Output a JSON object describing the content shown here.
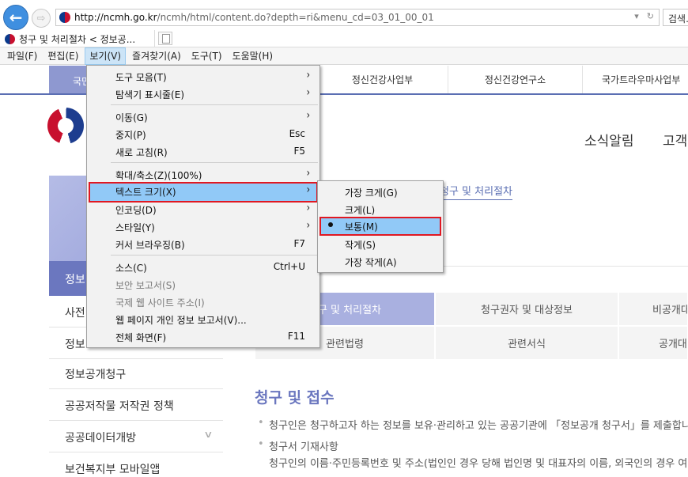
{
  "browser": {
    "url_prefix": "http://ncmh.go.kr",
    "url_rest": "/ncmh/html/content.do?depth=ri&menu_cd=03_01_00_01",
    "search_label": "검색...",
    "tab_title": "청구 및 처리절차 < 정보공...",
    "menubar": [
      "파일(F)",
      "편집(E)",
      "보기(V)",
      "즐겨찾기(A)",
      "도구(T)",
      "도움말(H)"
    ]
  },
  "view_menu": {
    "items": [
      {
        "label": "도구 모음(T)",
        "arrow": "›"
      },
      {
        "label": "탐색기 표시줄(E)",
        "arrow": "›"
      },
      {
        "label": "이동(G)",
        "arrow": "›"
      },
      {
        "label": "중지(P)",
        "shortcut": "Esc"
      },
      {
        "label": "새로 고침(R)",
        "shortcut": "F5"
      },
      {
        "label": "확대/축소(Z)(100%)",
        "arrow": "›"
      },
      {
        "label": "텍스트 크기(X)",
        "arrow": "›"
      },
      {
        "label": "인코딩(D)",
        "arrow": "›"
      },
      {
        "label": "스타일(Y)",
        "arrow": "›"
      },
      {
        "label": "커서 브라우징(B)",
        "shortcut": "F7"
      },
      {
        "label": "소스(C)",
        "shortcut": "Ctrl+U"
      },
      {
        "label": "보안 보고서(S)"
      },
      {
        "label": "국제 웹 사이트 주소(I)"
      },
      {
        "label": "웹 페이지 개인 정보 보고서(V)..."
      },
      {
        "label": "전체 화면(F)",
        "shortcut": "F11"
      }
    ]
  },
  "text_size_menu": {
    "items": [
      "가장 크게(G)",
      "크게(L)",
      "보통(M)",
      "작게(S)",
      "가장 작게(A)"
    ],
    "selected": "보통(M)"
  },
  "page": {
    "gnb": [
      "국민",
      "정신건강사업부",
      "정신건강연구소",
      "국가트라우마사업부"
    ],
    "top_nav": [
      "소식알림",
      "고객"
    ],
    "breadcrumb": "청구 및 처리절차",
    "side_menu": [
      "정보",
      "사전",
      "정보",
      "정보공개청구",
      "공공저작물 저작권 정책",
      "공공데이터개방",
      "보건복지부 모바일앱"
    ],
    "content_tabs": [
      "청구 및 처리절차",
      "청구권자 및 대상정보",
      "비공개대",
      "관련법령",
      "관련서식",
      "공개대"
    ],
    "section_title": "청구 및 접수",
    "paragraphs": [
      "청구인은 청구하고자 하는 정보를 보유·관리하고 있는 공공기관에 「정보공개 청구서」를 제출합니",
      "청구서 기재사항",
      "청구인의 이름·주민등록번호 및 주소(법인인 경우 당해 법인명 및 대표자의 이름, 외국인의 경우 여"
    ]
  }
}
